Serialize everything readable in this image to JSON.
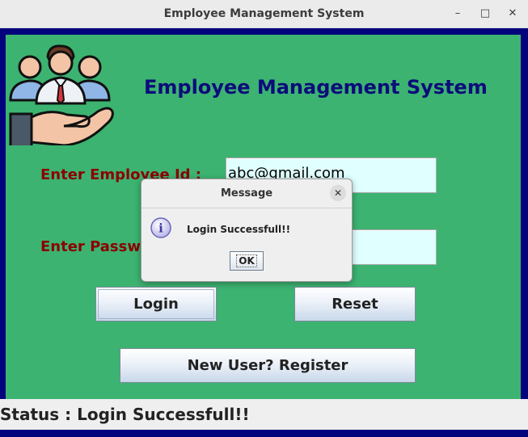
{
  "window": {
    "title": "Employee Management System",
    "controls": {
      "minimize": "–",
      "maximize": "□",
      "close": "✕"
    }
  },
  "main": {
    "logo_icon": "employees-in-hand-icon",
    "heading": "Employee Management System",
    "employee_id_label": "Enter Employee Id :",
    "employee_id_value": "abc@gmail.com",
    "password_label": "Enter Password :",
    "password_value": "",
    "login_button": "Login",
    "reset_button": "Reset",
    "register_button": "New User? Register"
  },
  "status_bar": {
    "text": "Status : Login Successfull!!"
  },
  "dialog": {
    "title": "Message",
    "message": "Login Successfull!!",
    "icon": "info-icon",
    "ok_button": "OK",
    "close_icon": "close-icon"
  },
  "colors": {
    "panel_bg": "#3cb371",
    "frame_border": "#03037d",
    "heading": "#0c0c7a",
    "label": "#8b0000",
    "field_bg": "#e0ffff"
  }
}
